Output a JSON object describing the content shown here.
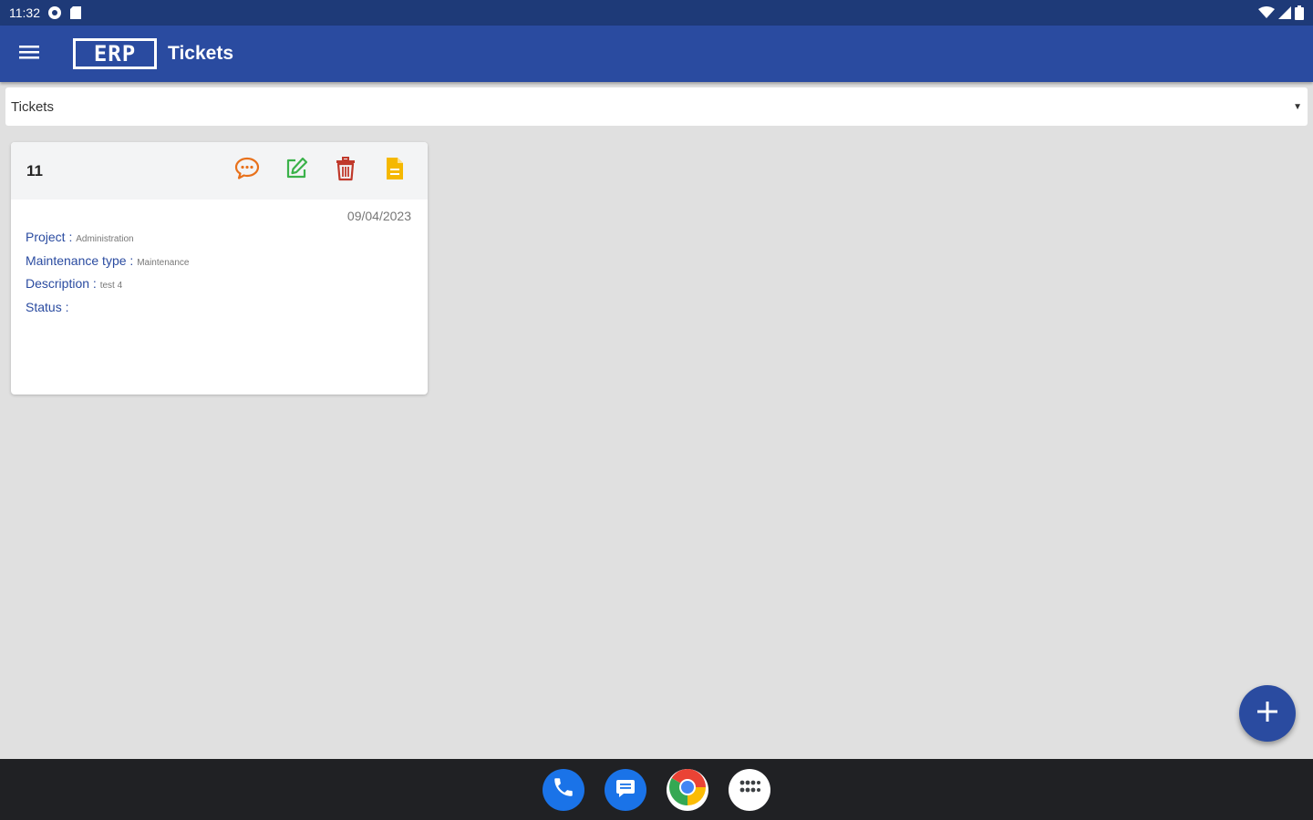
{
  "status_bar": {
    "time": "11:32"
  },
  "app_bar": {
    "logo_text": "ERP",
    "title": "Tickets"
  },
  "selector": {
    "value": "Tickets",
    "arrow": "▼"
  },
  "ticket": {
    "id": "11",
    "date": "09/04/2023",
    "fields": [
      {
        "label": "Project :",
        "value": "Administration"
      },
      {
        "label": "Maintenance type :",
        "value": "Maintenance"
      },
      {
        "label": "Description :",
        "value": "test 4"
      },
      {
        "label": "Status :",
        "value": ""
      }
    ],
    "actions": [
      "chat-icon",
      "edit-icon",
      "delete-icon",
      "document-icon"
    ]
  },
  "colors": {
    "primary": "#2a4ba0",
    "status_bar": "#1e3a78",
    "chat": "#e8711b",
    "edit": "#3bb24a",
    "delete": "#c0392b",
    "document": "#f5b800"
  }
}
